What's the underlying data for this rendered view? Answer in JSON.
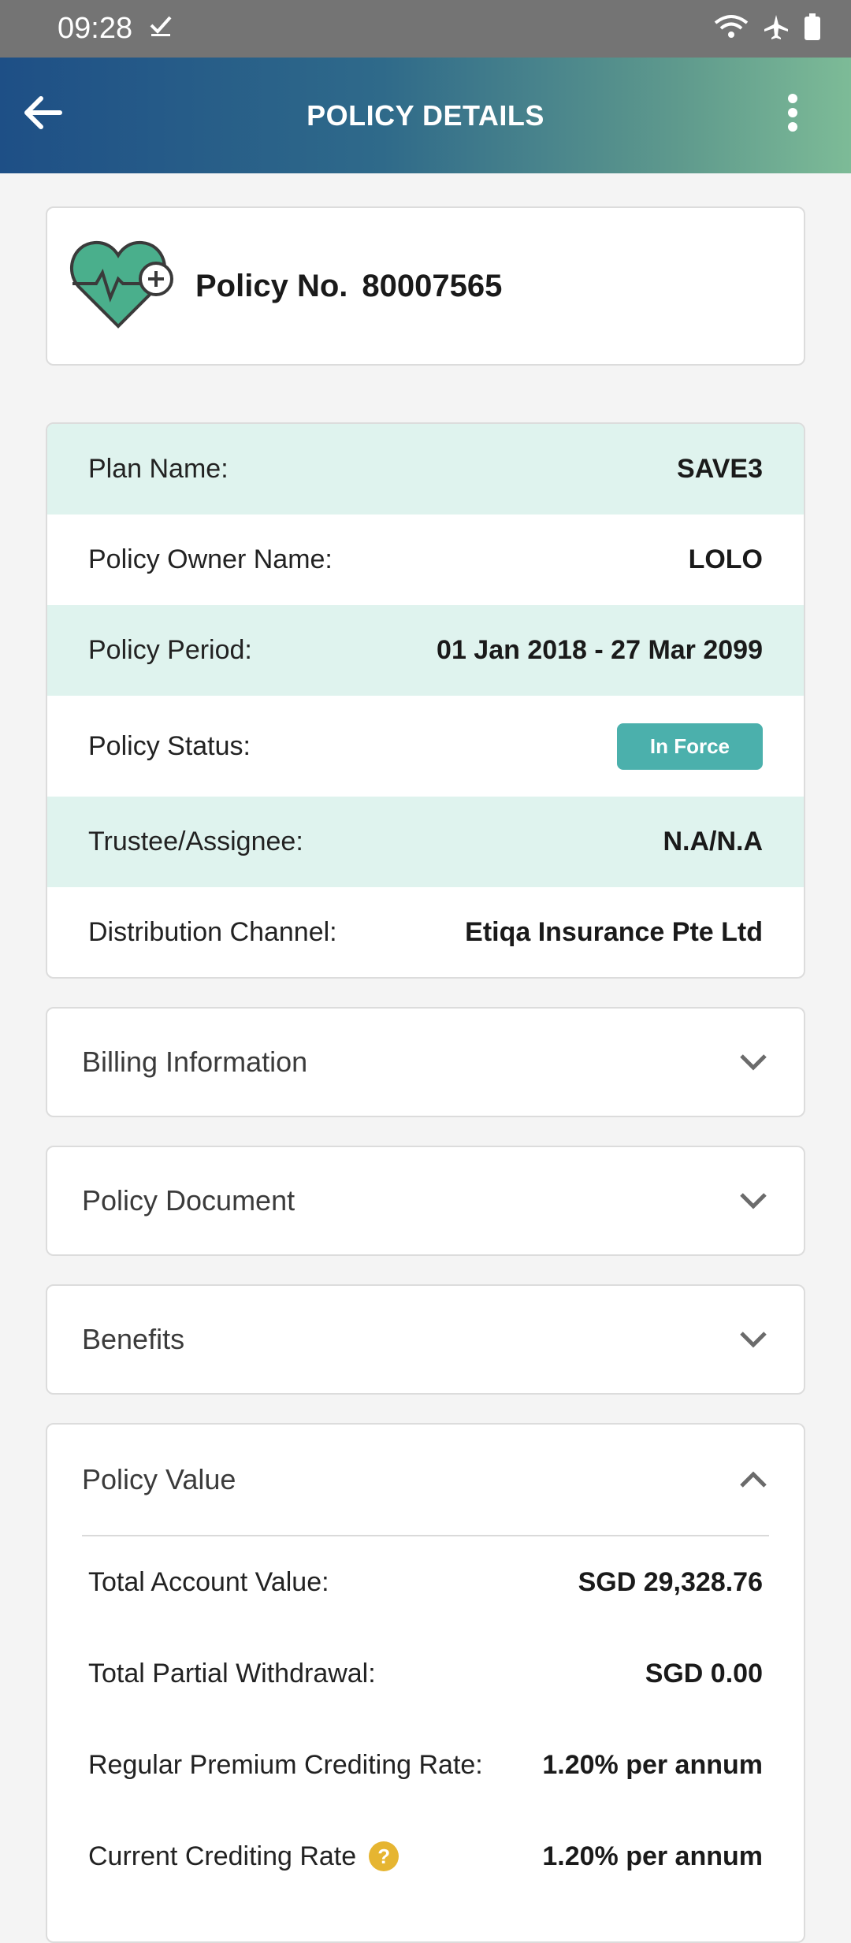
{
  "status_bar": {
    "time": "09:28"
  },
  "header": {
    "title": "POLICY DETAILS"
  },
  "policy": {
    "label": "Policy No.",
    "number": "80007565"
  },
  "details": [
    {
      "label": "Plan Name:",
      "value": "SAVE3"
    },
    {
      "label": "Policy Owner Name:",
      "value": "LOLO"
    },
    {
      "label": "Policy Period:",
      "value": "01 Jan 2018 - 27 Mar 2099"
    },
    {
      "label": "Policy Status:",
      "value": "In Force"
    },
    {
      "label": "Trustee/Assignee:",
      "value": "N.A/N.A"
    },
    {
      "label": "Distribution Channel:",
      "value": "Etiqa Insurance Pte Ltd"
    }
  ],
  "sections": {
    "billing": "Billing Information",
    "document": "Policy Document",
    "benefits": "Benefits",
    "policy_value": "Policy Value"
  },
  "policy_value": [
    {
      "label": "Total Account Value:",
      "value": "SGD 29,328.76"
    },
    {
      "label": "Total Partial Withdrawal:",
      "value": "SGD 0.00"
    },
    {
      "label": "Regular Premium Crediting Rate:",
      "value": "1.20% per annum"
    },
    {
      "label": "Current Crediting Rate",
      "value": "1.20% per annum"
    }
  ],
  "help_glyph": "?",
  "colors": {
    "accent": "#4bb0ac",
    "tint": "#dff3ee",
    "help": "#e6b531"
  }
}
